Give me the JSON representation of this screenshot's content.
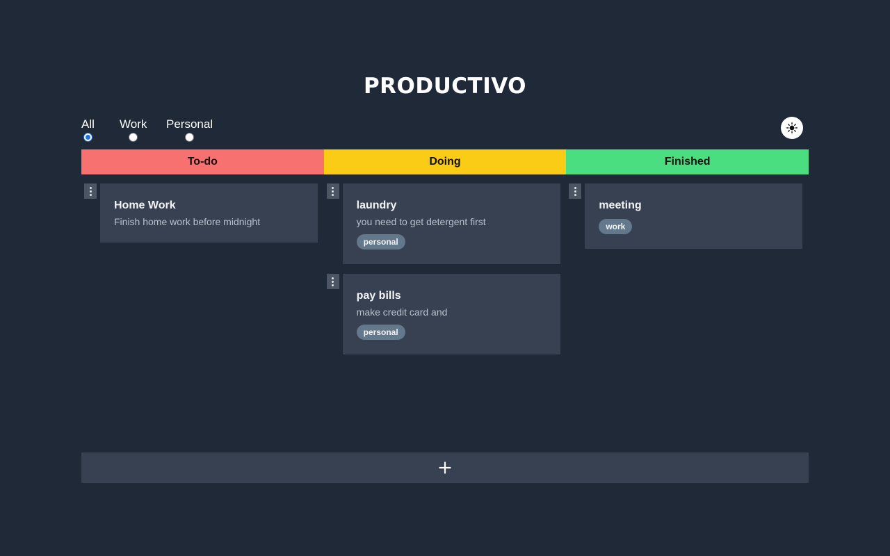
{
  "app": {
    "title": "PRODUCTIVO"
  },
  "filters": {
    "options": [
      {
        "label": "All",
        "checked": true
      },
      {
        "label": "Work",
        "checked": false
      },
      {
        "label": "Personal",
        "checked": false
      }
    ]
  },
  "theme_toggle": {
    "icon": "sun-icon"
  },
  "columns": [
    {
      "title": "To-do",
      "color": "#f87171",
      "cards": [
        {
          "title": "Home Work",
          "description": "Finish home work before midnight",
          "tag": ""
        }
      ]
    },
    {
      "title": "Doing",
      "color": "#facc15",
      "cards": [
        {
          "title": "laundry",
          "description": "you need to get detergent first",
          "tag": "personal"
        },
        {
          "title": "pay bills",
          "description": "make credit card and",
          "tag": "personal"
        }
      ]
    },
    {
      "title": "Finished",
      "color": "#4ade80",
      "cards": [
        {
          "title": "meeting",
          "description": "",
          "tag": "work"
        }
      ]
    }
  ],
  "add_button": {
    "icon": "plus-icon"
  }
}
